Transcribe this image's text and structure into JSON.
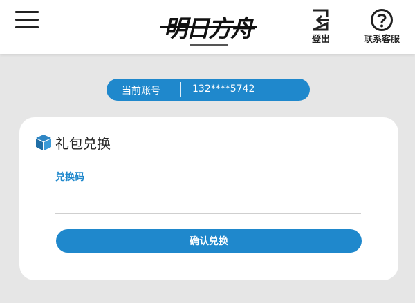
{
  "header": {
    "logo_text": "明日方舟",
    "logout_label": "登出",
    "service_label": "联系客服"
  },
  "account": {
    "label": "当前账号",
    "value": "132****5742"
  },
  "gift": {
    "title": "礼包兑换",
    "field_label": "兑换码",
    "code_value": "",
    "confirm_label": "确认兑换"
  },
  "colors": {
    "accent": "#1f88cc",
    "background": "#e6e6e6",
    "card": "#ffffff"
  },
  "icons": {
    "menu": "hamburger-menu-icon",
    "logout": "logout-icon",
    "service": "help-circle-icon",
    "gift": "gift-box-icon"
  }
}
